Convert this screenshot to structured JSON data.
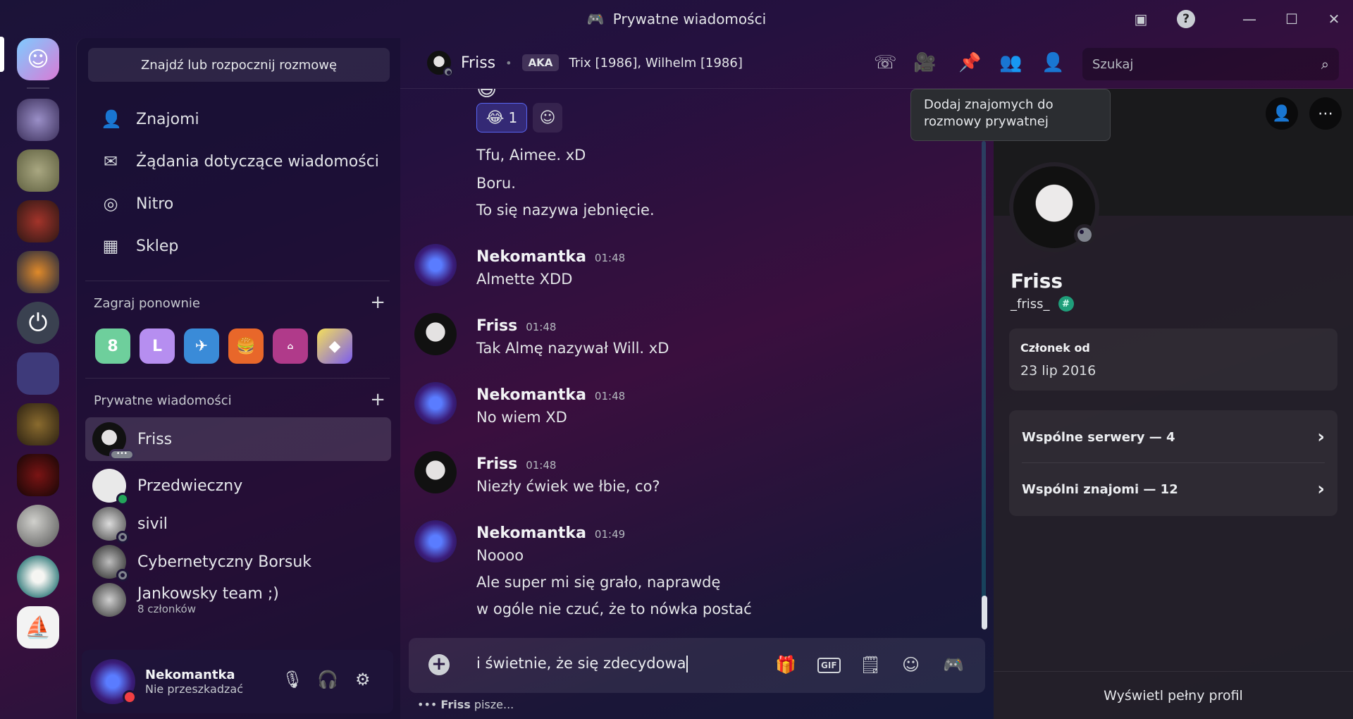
{
  "titlebar": {
    "title": "Prywatne wiadomości"
  },
  "sidebar": {
    "find_label": "Znajdź lub rozpocznij rozmowę",
    "nav": [
      {
        "label": "Znajomi",
        "icon": "friends-icon"
      },
      {
        "label": "Żądania dotyczące wiadomości",
        "icon": "envelope-icon"
      },
      {
        "label": "Nitro",
        "icon": "nitro-icon"
      },
      {
        "label": "Sklep",
        "icon": "shop-icon"
      }
    ],
    "play_again": "Zagraj ponownie",
    "dms_header": "Prywatne wiadomości",
    "dms": [
      {
        "name": "Friss",
        "sub": ""
      },
      {
        "name": "Przedwieczny",
        "sub": ""
      },
      {
        "name": "sivil",
        "sub": ""
      },
      {
        "name": "Cybernetyczny Borsuk",
        "sub": ""
      },
      {
        "name": "Jankowsky team ;)",
        "sub": "8 członków"
      }
    ]
  },
  "user": {
    "name": "Nekomantka",
    "status": "Nie przeszkadzać"
  },
  "header": {
    "name": "Friss",
    "aka": "AKA",
    "aka_names": "Trix [1986], Wilhelm [1986]",
    "search_placeholder": "Szukaj"
  },
  "tooltip": "Dodaj znajomych do rozmowy prywatnej",
  "messages": {
    "reaction_count": "1",
    "cont_lines": [
      "Tfu, Aimee. xD",
      "Boru.",
      "To się nazywa jebnięcie."
    ],
    "groups": [
      {
        "author": "Nekomantka",
        "time": "01:48",
        "lines": [
          "Almette XDD"
        ]
      },
      {
        "author": "Friss",
        "time": "01:48",
        "lines": [
          "Tak Almę nazywał Will. xD"
        ]
      },
      {
        "author": "Nekomantka",
        "time": "01:48",
        "lines": [
          "No wiem XD"
        ]
      },
      {
        "author": "Friss",
        "time": "01:48",
        "lines": [
          "Niezły ćwiek we łbie, co?"
        ]
      },
      {
        "author": "Nekomantka",
        "time": "01:49",
        "lines": [
          "Noooo",
          "Ale super mi się grało, naprawdę",
          "w ogóle nie czuć, że to nówka postać"
        ]
      }
    ]
  },
  "composer": {
    "text": "i świetnie, że się zdecydowa",
    "typing_name": "Friss",
    "typing_suffix": "pisze..."
  },
  "profile": {
    "name": "Friss",
    "tag": "_friss_",
    "member_label": "Członek od",
    "member_date": "23 lip 2016",
    "servers": "Wspólne serwery — 4",
    "friends": "Wspólni znajomi — 12",
    "full_profile": "Wyświetl pełny profil"
  }
}
